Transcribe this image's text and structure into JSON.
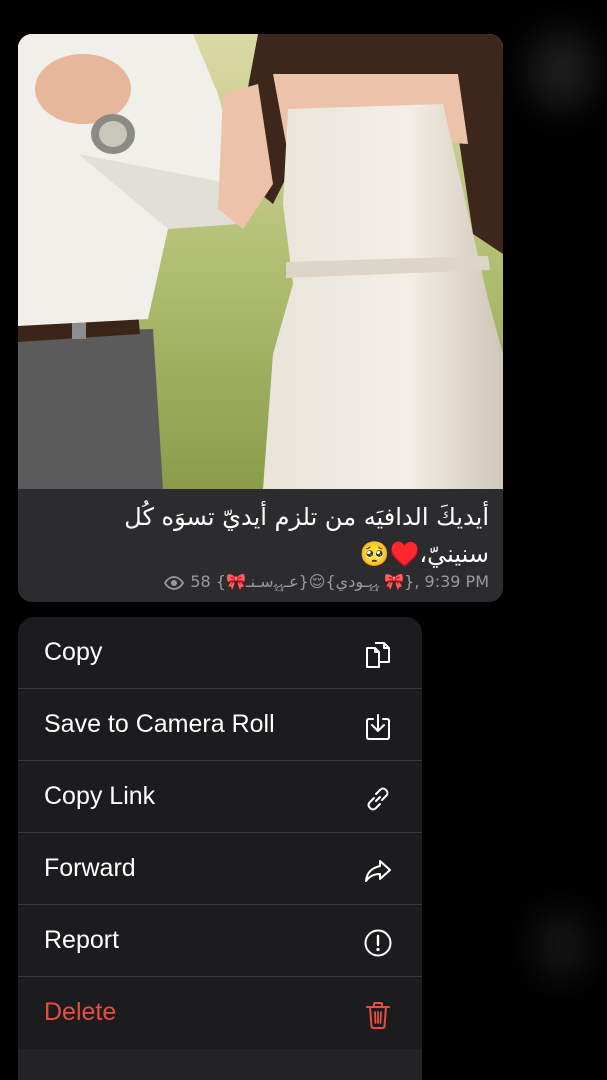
{
  "message": {
    "caption_line1": "أيديكَ الدافيَه من تلزم أيديّ تسوَه كُل",
    "caption_line2": "سنينيّ،♥️🥺",
    "meta": "58 {🎀عـﮩ͢ﮩسـنـ}😌{ﮩ͢ﮩـودي 🎀}, 9:39 PM"
  },
  "menu": {
    "items": [
      {
        "label": "Copy",
        "icon": "copy-icon"
      },
      {
        "label": "Save to Camera Roll",
        "icon": "download-icon"
      },
      {
        "label": "Copy Link",
        "icon": "link-icon"
      },
      {
        "label": "Forward",
        "icon": "forward-icon"
      },
      {
        "label": "Report",
        "icon": "report-icon"
      },
      {
        "label": "Delete",
        "icon": "trash-icon"
      }
    ]
  },
  "colors": {
    "menu_background": "#1c1c1e",
    "bubble_background": "#2c2c2e",
    "destructive": "#ea4c3f",
    "meta_text": "#9a9a9e"
  }
}
